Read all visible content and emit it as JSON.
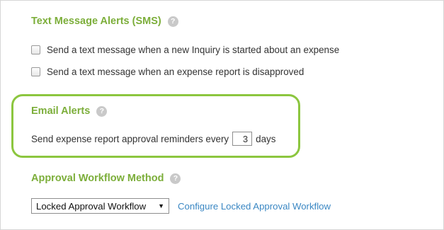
{
  "sms": {
    "title": "Text Message Alerts (SMS)",
    "help": "?",
    "options": [
      {
        "label": "Send a text message when a new Inquiry is started about an expense",
        "checked": false
      },
      {
        "label": "Send a text message when an expense report is disapproved",
        "checked": false
      }
    ]
  },
  "email": {
    "title": "Email Alerts",
    "help": "?",
    "reminder_prefix": "Send expense report approval reminders every",
    "reminder_value": "3",
    "reminder_suffix": "days",
    "highlight_color": "#8cc63f"
  },
  "workflow": {
    "title": "Approval Workflow Method",
    "help": "?",
    "selected": "Locked Approval Workflow",
    "configure_link": "Configure Locked Approval Workflow"
  },
  "colors": {
    "section_title": "#7cae3a",
    "link": "#3a87c3"
  },
  "icons": {
    "help": "question-circle-icon",
    "dropdown": "triangle-down-icon"
  }
}
